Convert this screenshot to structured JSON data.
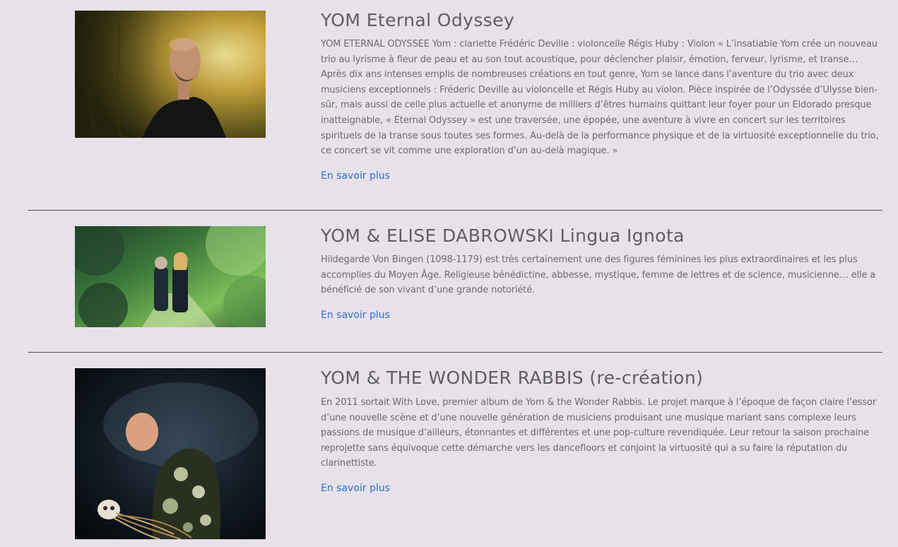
{
  "entries": [
    {
      "title": "YOM Eternal Odyssey",
      "description": "YOM ETERNAL ODYSSEE Yom : clariette Frédéric Deville : violoncelle Régis Huby : Violon « L’insatiable Yom crée un nouveau trio au lyrisme à fleur de peau et au son tout acoustique, pour déclencher plaisir, émotion, ferveur, lyrisme, et transe… Après dix ans intenses emplis de nombreuses créations en tout genre, Yom se lance dans l’aventure du trio avec deux musiciens exceptionnels : Fréderic Deville au violoncelle et Régis Huby au violon. Pièce inspirée de l’Odyssée d’Ulysse bien-sûr, mais aussi de celle plus actuelle et anonyme de milliers d’êtres humains quittant leur foyer pour un Eldorado presque inatteignable, « Eternal Odyssey » est une traversée, une épopée, une aventure à vivre en concert sur les territoires spirituels de la transe sous toutes ses formes. Au-delà de la performance physique et de la virtuosité exceptionnelle du trio, ce concert se vit comme une exploration d’un au-delà magique. »",
      "link_label": "En savoir plus"
    },
    {
      "title": "YOM & ELISE DABROWSKI Lingua Ignota",
      "description": "Hildegarde Von Bingen (1098-1179) est très certainement une des figures féminines les plus extraordinaires et les plus accomplies du Moyen Âge. Religieuse bénédictine, abbesse, mystique, femme de lettres et de science, musicienne… elle a bénéficié de son vivant d’une grande notoriété.",
      "link_label": "En savoir plus"
    },
    {
      "title": "YOM & THE WONDER RABBIS (re-création)",
      "description": "En 2011 sortait With Love, premier album de Yom & the Wonder Rabbis. Le projet marque à l’époque de façon claire l’essor d’une nouvelle scène et d’une nouvelle génération de musiciens produisant une musique mariant sans complexe leurs passions de musique d’ailleurs, étonnantes et différentes et une pop-culture revendiquée. Leur retour la saison prochaine reprojette sans équivoque cette démarche vers les dancefloors et conjoint la virtuosité qui a su faire la réputation du clarinettiste.",
      "link_label": "En savoir plus"
    }
  ],
  "colors": {
    "background": "#e8e1ea",
    "title": "#5e5e62",
    "text": "#6b6b6f",
    "link": "#2b6fd6",
    "separator": "#4b4b4f"
  }
}
